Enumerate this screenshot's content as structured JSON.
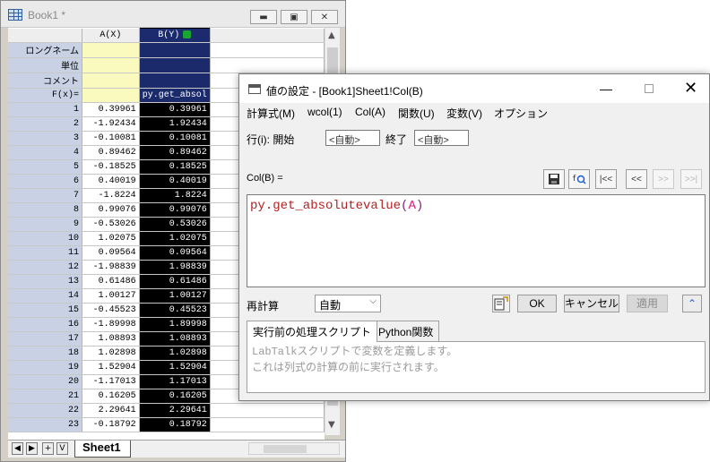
{
  "book": {
    "title": "Book1 *",
    "columns": {
      "a": "A(X)",
      "b": "B(Y)"
    },
    "meta_labels": [
      "ロングネーム",
      "単位",
      "コメント",
      "F(x)="
    ],
    "fx_b": "py.get_absol",
    "rows": [
      {
        "n": "1",
        "a": "0.39961",
        "b": "0.39961"
      },
      {
        "n": "2",
        "a": "-1.92434",
        "b": "1.92434"
      },
      {
        "n": "3",
        "a": "-0.10081",
        "b": "0.10081"
      },
      {
        "n": "4",
        "a": "0.89462",
        "b": "0.89462"
      },
      {
        "n": "5",
        "a": "-0.18525",
        "b": "0.18525"
      },
      {
        "n": "6",
        "a": "0.40019",
        "b": "0.40019"
      },
      {
        "n": "7",
        "a": "-1.8224",
        "b": "1.8224"
      },
      {
        "n": "8",
        "a": "0.99076",
        "b": "0.99076"
      },
      {
        "n": "9",
        "a": "-0.53026",
        "b": "0.53026"
      },
      {
        "n": "10",
        "a": "1.02075",
        "b": "1.02075"
      },
      {
        "n": "11",
        "a": "0.09564",
        "b": "0.09564"
      },
      {
        "n": "12",
        "a": "-1.98839",
        "b": "1.98839"
      },
      {
        "n": "13",
        "a": "0.61486",
        "b": "0.61486"
      },
      {
        "n": "14",
        "a": "1.00127",
        "b": "1.00127"
      },
      {
        "n": "15",
        "a": "-0.45523",
        "b": "0.45523"
      },
      {
        "n": "16",
        "a": "-1.89998",
        "b": "1.89998"
      },
      {
        "n": "17",
        "a": "1.08893",
        "b": "1.08893"
      },
      {
        "n": "18",
        "a": "1.02898",
        "b": "1.02898"
      },
      {
        "n": "19",
        "a": "1.52904",
        "b": "1.52904"
      },
      {
        "n": "20",
        "a": "-1.17013",
        "b": "1.17013"
      },
      {
        "n": "21",
        "a": "0.16205",
        "b": "0.16205"
      },
      {
        "n": "22",
        "a": "2.29641",
        "b": "2.29641"
      },
      {
        "n": "23",
        "a": "-0.18792",
        "b": "0.18792"
      }
    ],
    "sheet_tab": "Sheet1",
    "nav_buttons": [
      "◀",
      "▶",
      "+",
      "V"
    ]
  },
  "dialog": {
    "title": "値の設定 - [Book1]Sheet1!Col(B)",
    "menu": [
      "計算式(M)",
      "wcol(1)",
      "Col(A)",
      "関数(U)",
      "変数(V)",
      "オプション"
    ],
    "row_label": "行(i): 開始",
    "start_value": "<自動>",
    "end_label": "終了",
    "end_value": "<自動>",
    "col_label": "Col(B) =",
    "formula": {
      "func": "py.get_absolutevalue",
      "open": "(",
      "arg": "A",
      "close": ")"
    },
    "recalc_label": "再計算",
    "recalc_value": "自動",
    "ok": "OK",
    "cancel": "キャンセル",
    "apply": "適用",
    "tabs": [
      "実行前の処理スクリプト",
      "Python関数"
    ],
    "script_line1": "LabTalkスクリプトで変数を定義します。",
    "script_line2": "これは列式の計算の前に実行されます。",
    "toolbar": [
      "|<<",
      "<<",
      ">>",
      ">>|"
    ]
  }
}
